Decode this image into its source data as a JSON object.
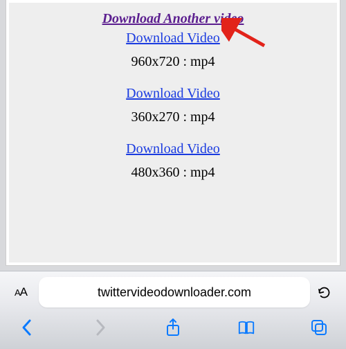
{
  "page": {
    "top_link_label": "Download Another video",
    "items": [
      {
        "link_label": "Download Video",
        "resolution": "960x720 : mp4"
      },
      {
        "link_label": "Download Video",
        "resolution": "360x270 : mp4"
      },
      {
        "link_label": "Download Video",
        "resolution": "480x360 : mp4"
      }
    ]
  },
  "browser": {
    "text_size_label": "AA",
    "url_display": "twittervideodownloader.com"
  },
  "colors": {
    "visited_link": "#5b1e8f",
    "link": "#1a3be0",
    "toolbar_blue": "#0a7aff",
    "toolbar_disabled": "#b7b9bf",
    "arrow": "#e2231a"
  }
}
